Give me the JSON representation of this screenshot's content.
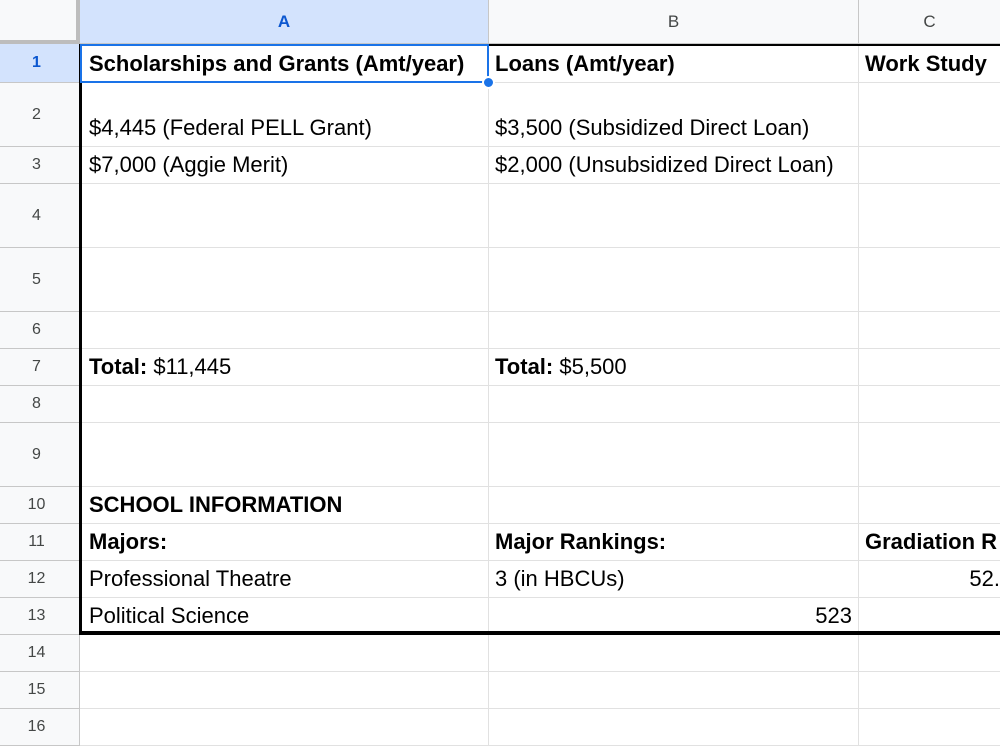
{
  "columns": [
    "A",
    "B",
    "C"
  ],
  "rows": [
    "1",
    "2",
    "3",
    "4",
    "5",
    "6",
    "7",
    "8",
    "9",
    "10",
    "11",
    "12",
    "13",
    "14",
    "15",
    "16"
  ],
  "cells": {
    "A1": "Scholarships and Grants (Amt/year)",
    "B1": "Loans (Amt/year)",
    "C1": "Work Study",
    "A2": "$4,445 (Federal PELL Grant)",
    "B2": "$3,500 (Subsidized Direct Loan)",
    "A3": "$7,000 (Aggie Merit)",
    "B3": "$2,000 (Unsubsidized Direct Loan)",
    "A7_label": "Total:",
    "A7_value": " $11,445",
    "B7_label": "Total:",
    "B7_value": " $5,500",
    "A10": "SCHOOL INFORMATION",
    "A11": "Majors:",
    "B11": "Major Rankings:",
    "C11": "Gradiation R",
    "A12": "Professional Theatre",
    "B12": "3 (in HBCUs)",
    "C12": "52.",
    "A13": "Political Science",
    "B13": "523"
  },
  "selected_cell": "A1",
  "colors": {
    "selection": "#1a73e8",
    "header_active_bg": "#d3e3fd",
    "header_active_text": "#0b57d0"
  }
}
